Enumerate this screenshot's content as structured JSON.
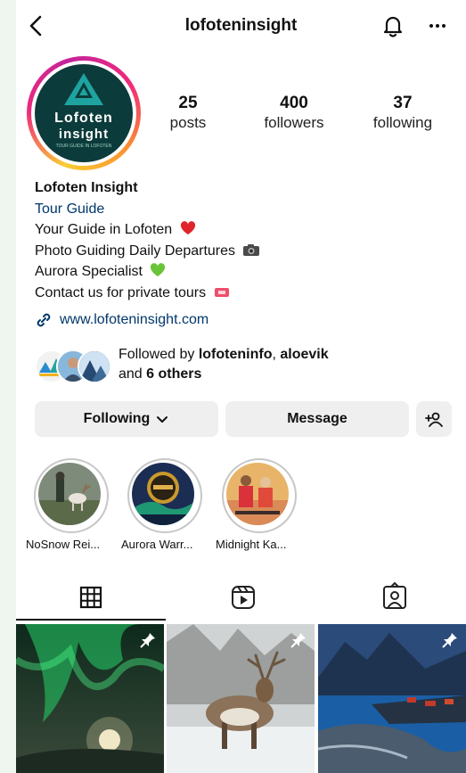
{
  "header": {
    "username": "lofoteninsight",
    "back_icon": "chevron-left-icon",
    "notifications_icon": "bell-icon",
    "more_icon": "more-horizontal-icon"
  },
  "avatar": {
    "logo_line1": "Lofoten",
    "logo_line2": "insight",
    "logo_tagline": "TOUR GUIDE IN LOFOTEN"
  },
  "stats": {
    "posts_count": "25",
    "posts_label": "posts",
    "followers_count": "400",
    "followers_label": "followers",
    "following_count": "37",
    "following_label": "following"
  },
  "bio": {
    "name": "Lofoten Insight",
    "category": "Tour Guide",
    "lines": [
      "Your Guide in Lofoten",
      "Photo Guiding Daily Departures",
      "Aurora Specialist",
      "Contact us for private tours"
    ],
    "link": "www.lofoteninsight.com"
  },
  "mutual": {
    "prefix": "Followed by ",
    "user1": "lofoteninfo",
    "separator": ", ",
    "user2": "aloevik",
    "and": "and ",
    "others": "6 others"
  },
  "actions": {
    "following_label": "Following",
    "message_label": "Message",
    "add_person_icon": "add-person-icon"
  },
  "highlights": [
    {
      "label": "NoSnow Rei..."
    },
    {
      "label": "Aurora Warr..."
    },
    {
      "label": "Midnight Ka..."
    }
  ],
  "tabs": {
    "active": "grid",
    "icons": [
      "grid-icon",
      "reels-icon",
      "tagged-icon"
    ]
  },
  "colors": {
    "link": "#00376b",
    "button_bg": "#efefef",
    "avatar_bg": "#0c3b3b",
    "logo_accent": "#1fa3a0"
  }
}
